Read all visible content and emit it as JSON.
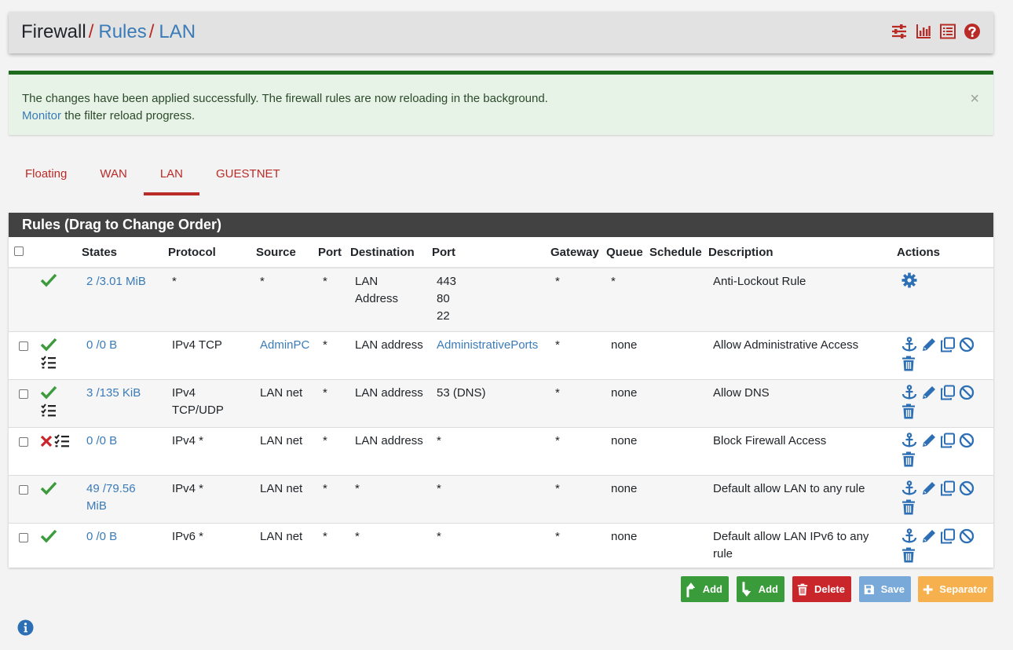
{
  "breadcrumb": {
    "first": "Firewall",
    "second": "Rules",
    "third": "LAN",
    "separator": "/"
  },
  "header_icons": [
    "sliders-icon",
    "bar-chart-icon",
    "list-icon",
    "help-icon"
  ],
  "alert": {
    "message": "The changes have been applied successfully. The firewall rules are now reloading in the background.",
    "link_text": "Monitor",
    "link_suffix": "the filter reload progress.",
    "close": "×"
  },
  "tabs": [
    {
      "label": "Floating",
      "active": false
    },
    {
      "label": "WAN",
      "active": false
    },
    {
      "label": "LAN",
      "active": true
    },
    {
      "label": "GUESTNET",
      "active": false
    }
  ],
  "panel_title": "Rules (Drag to Change Order)",
  "columns": {
    "states": "States",
    "protocol": "Protocol",
    "source": "Source",
    "port": "Port",
    "destination": "Destination",
    "dport": "Port",
    "gateway": "Gateway",
    "queue": "Queue",
    "schedule": "Schedule",
    "description": "Description",
    "actions": "Actions"
  },
  "rules": [
    {
      "states": "2 /3.01 MiB",
      "protocol": "*",
      "source": "*",
      "port": "*",
      "destination": "LAN Address",
      "dport": "443 80 22",
      "gateway": "*",
      "queue": "*",
      "schedule": "",
      "description": "Anti-Lockout Rule",
      "status": "pass",
      "logged": false
    },
    {
      "states": "0 /0 B",
      "protocol": "IPv4 TCP",
      "source": "AdminPC",
      "port": "*",
      "destination": "LAN address",
      "dport": "AdministrativePorts",
      "gateway": "*",
      "queue": "none",
      "schedule": "",
      "description": "Allow Administrative Access",
      "status": "pass",
      "logged": true
    },
    {
      "states": "3 /135 KiB",
      "protocol": "IPv4 TCP/UDP",
      "source": "LAN net",
      "port": "*",
      "destination": "LAN address",
      "dport": "53 (DNS)",
      "gateway": "*",
      "queue": "none",
      "schedule": "",
      "description": "Allow DNS",
      "status": "pass",
      "logged": true
    },
    {
      "states": "0 /0 B",
      "protocol": "IPv4 *",
      "source": "LAN net",
      "port": "*",
      "destination": "LAN address",
      "dport": "*",
      "gateway": "*",
      "queue": "none",
      "schedule": "",
      "description": "Block Firewall Access",
      "status": "block",
      "logged": true
    },
    {
      "states": "49 /79.56 MiB",
      "protocol": "IPv4 *",
      "source": "LAN net",
      "port": "*",
      "destination": "*",
      "dport": "*",
      "gateway": "*",
      "queue": "none",
      "schedule": "",
      "description": "Default allow LAN to any rule",
      "status": "pass",
      "logged": false
    },
    {
      "states": "0 /0 B",
      "protocol": "IPv6 *",
      "source": "LAN net",
      "port": "*",
      "destination": "*",
      "dport": "*",
      "gateway": "*",
      "queue": "none",
      "schedule": "",
      "description": "Default allow LAN IPv6 to any rule",
      "status": "pass",
      "logged": false
    }
  ],
  "buttons": {
    "add_top": "Add",
    "add_bottom": "Add",
    "delete": "Delete",
    "save": "Save",
    "separator": "Separator"
  },
  "colors": {
    "accent_red": "#b92b27",
    "link_blue": "#3a7bb8",
    "pass_green": "#3d9a3d",
    "block_red": "#c9262b",
    "panel_dark": "#424242",
    "alert_bg": "#e6f3e6"
  }
}
